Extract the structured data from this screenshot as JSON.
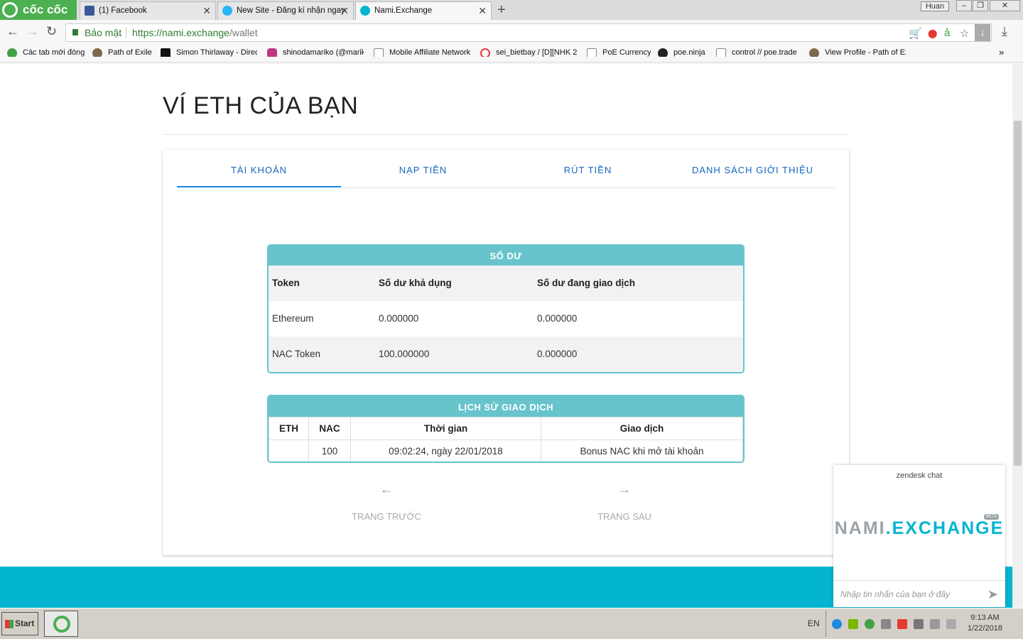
{
  "browser": {
    "brand": "cốc cốc",
    "tabs": [
      {
        "label": "(1) Facebook",
        "icon": "facebook-icon",
        "color": "#3b5998"
      },
      {
        "label": "New Site - Đăng kí nhận ngay",
        "icon": "site-icon",
        "color": "#29b6f6"
      },
      {
        "label": "Nami.Exchange",
        "icon": "nami-icon",
        "color": "#04b5d0"
      }
    ],
    "new_tab": "+",
    "user": "Huan",
    "secure_label": "Bảo mật",
    "url_host": "https://nami.exchange",
    "url_path": "/wallet",
    "bookmarks": [
      {
        "label": "Các tab mới đóng",
        "icon": "recent-icon",
        "color": "#43a047"
      },
      {
        "label": "Path of Exile",
        "icon": "poe-icon",
        "color": "#7b6a4e"
      },
      {
        "label": "Simon Thirlaway - Direct",
        "icon": "s-icon",
        "color": "#111111"
      },
      {
        "label": "shinodamariko (@mariko",
        "icon": "instagram-icon",
        "color": "#c13584"
      },
      {
        "label": "Mobile Affiliate Network",
        "icon": "page-icon",
        "color": "#eeeeee"
      },
      {
        "label": "sei_bietbay / [D][NHK 2",
        "icon": "spiral-icon",
        "color": "#e53935"
      },
      {
        "label": "PoE Currency",
        "icon": "page-icon",
        "color": "#eeeeee"
      },
      {
        "label": "poe.ninja",
        "icon": "ninja-icon",
        "color": "#222222"
      },
      {
        "label": "control // poe.trade",
        "icon": "page-icon",
        "color": "#eeeeee"
      },
      {
        "label": "View Profile - Path of Ex",
        "icon": "poe-icon",
        "color": "#7b6a4e"
      }
    ],
    "bookmarks_more": "»"
  },
  "page": {
    "title": "VÍ ETH CỦA BẠN",
    "tabs": [
      "TÀI KHOẢN",
      "NẠP TIỀN",
      "RÚT TIỀN",
      "DANH SÁCH GIỚI THIỆU"
    ],
    "active_tab": 0,
    "balance": {
      "heading": "SỐ DƯ",
      "columns": [
        "Token",
        "Số dư khả dụng",
        "Số dư đang giao dịch"
      ],
      "rows": [
        [
          "Ethereum",
          "0.000000",
          "0.000000"
        ],
        [
          "NAC Token",
          "100.000000",
          "0.000000"
        ]
      ]
    },
    "history": {
      "heading": "LỊCH SỬ GIAO DỊCH",
      "columns": [
        "ETH",
        "NAC",
        "Thời gian",
        "Giao dịch"
      ],
      "rows": [
        [
          "",
          "100",
          "09:02:24, ngày 22/01/2018",
          "Bonus NAC khi mở tài khoản"
        ]
      ]
    },
    "pager": {
      "prev": "TRANG TRƯỚC",
      "next": "TRANG SAU",
      "prev_arrow": "←",
      "next_arrow": "→"
    }
  },
  "chat": {
    "title": "zendesk chat",
    "logo_a": "NAMI",
    "logo_dot": ".",
    "logo_b": "EXCHANGE",
    "beta": "BETA",
    "placeholder": "Nhập tin nhắn của bạn ở đây"
  },
  "taskbar": {
    "start": "Start",
    "lang": "EN",
    "time": "9:13 AM",
    "date": "1/22/2018"
  }
}
